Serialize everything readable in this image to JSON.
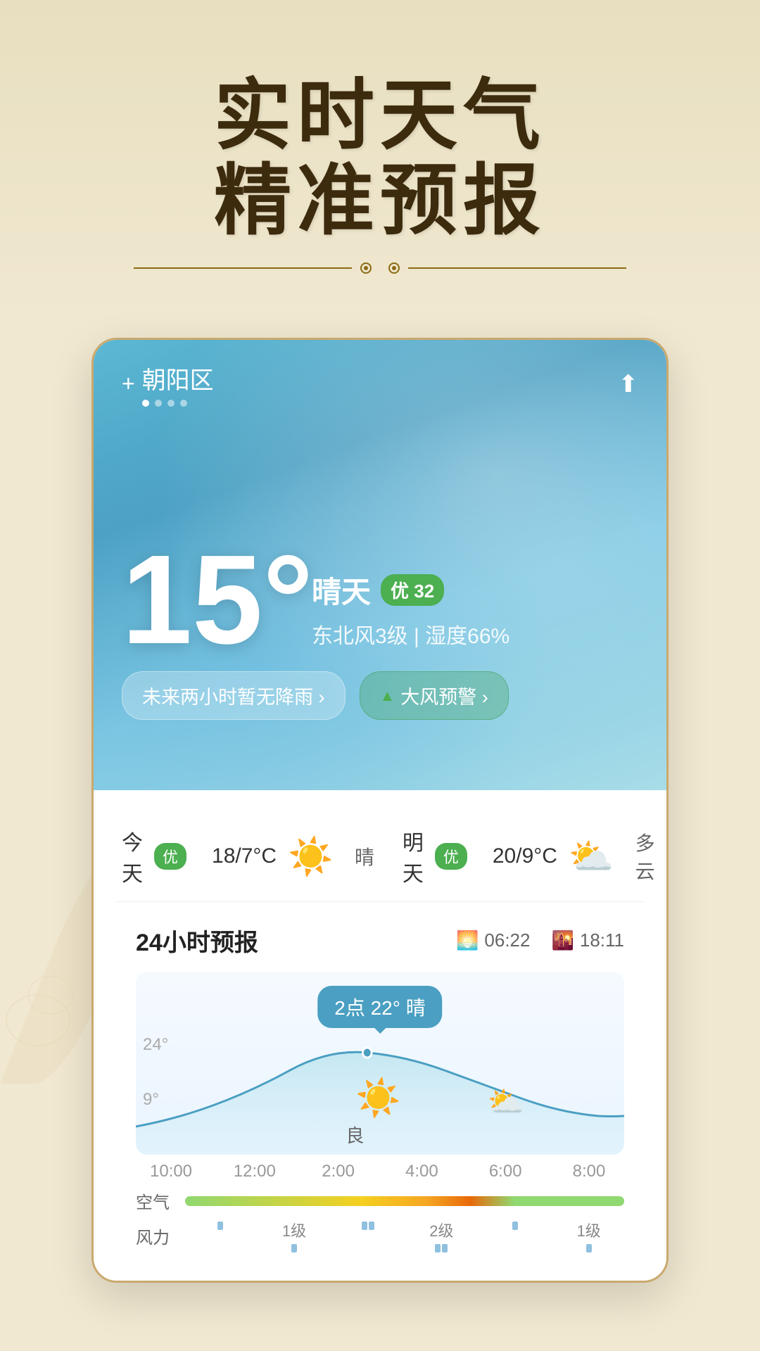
{
  "hero": {
    "title1": "实时天气",
    "title2": "精准预报"
  },
  "location": {
    "name": "朝阳区",
    "plus_label": "+",
    "dots": [
      true,
      false,
      false,
      false
    ]
  },
  "share_icon": "⬆",
  "current_weather": {
    "temperature": "15°",
    "condition": "晴天",
    "aqi_label": "优",
    "aqi_value": "32",
    "wind": "东北风3级",
    "humidity": "湿度66%",
    "alert1": "未来两小时暂无降雨 ›",
    "alert2": "大风预警 ›"
  },
  "daily_forecast": [
    {
      "label": "今天",
      "badge": "优",
      "temp": "18/7°C",
      "condition": "晴",
      "icon": "☀️"
    },
    {
      "label": "明天",
      "badge": "优",
      "temp": "20/9°C",
      "condition": "多云",
      "icon": "⛅"
    }
  ],
  "hourly_forecast": {
    "title": "24小时预报",
    "sunrise": "06:22",
    "sunset": "18:11",
    "tooltip": "2点 22° 晴",
    "temp_high_label": "24°",
    "temp_low_label": "9°",
    "sun_icon": "☀️",
    "cloud_icon": "⛅",
    "liang_label": "良",
    "time_labels": [
      "10:00",
      "12:00",
      "2:00",
      "4:00",
      "6:00",
      "8:00"
    ],
    "wind_label": "风力",
    "air_label": "空气",
    "wind_levels": [
      {
        "label": "1级",
        "time": "12:00"
      },
      {
        "label": "2级",
        "time": "6:00"
      },
      {
        "label": "1级",
        "time": "8:00"
      }
    ]
  }
}
